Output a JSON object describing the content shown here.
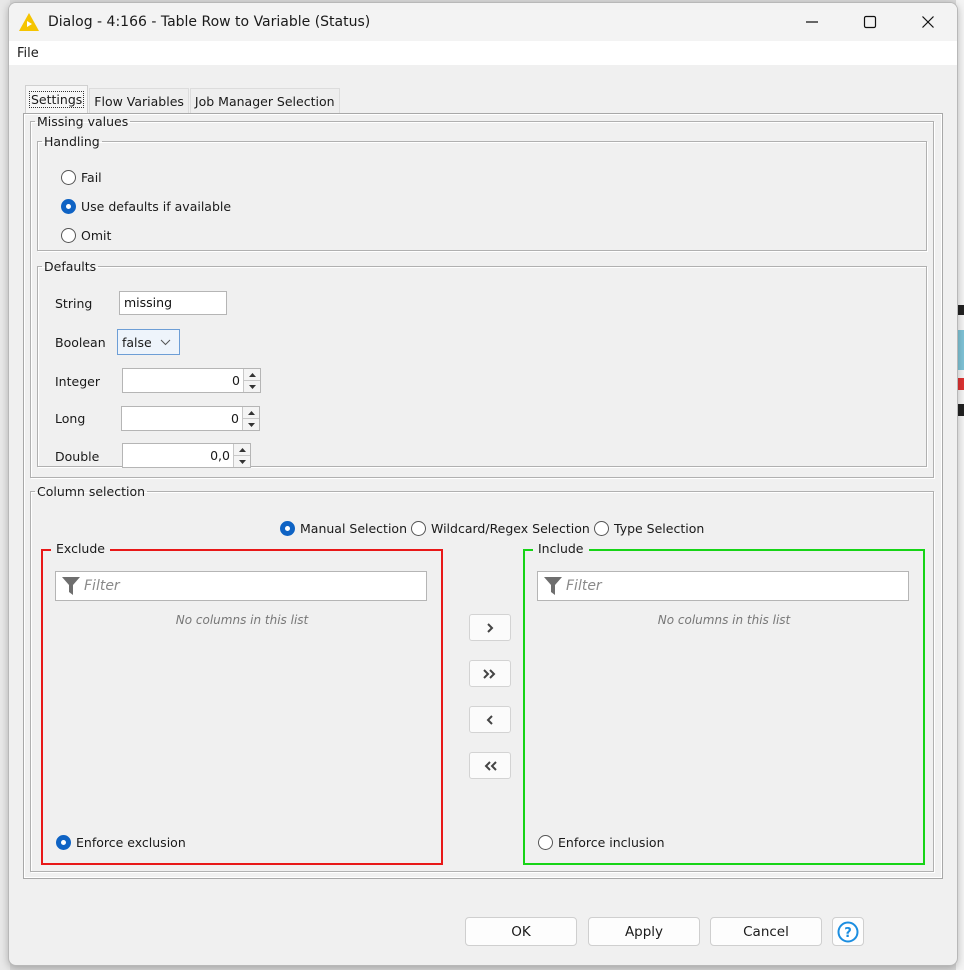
{
  "window": {
    "title": "Dialog - 4:166 - Table Row to Variable (Status)",
    "app_icon": "knime-warning-triangle-icon",
    "controls": [
      "minimize-icon",
      "maximize-icon",
      "close-icon"
    ]
  },
  "menubar": {
    "items": [
      {
        "label": "File"
      }
    ]
  },
  "tabs": [
    {
      "label": "Settings",
      "active": true
    },
    {
      "label": "Flow Variables",
      "active": false
    },
    {
      "label": "Job Manager Selection",
      "active": false
    }
  ],
  "settings": {
    "missing_values": {
      "legend": "Missing values",
      "handling": {
        "legend": "Handling",
        "options": [
          {
            "label": "Fail",
            "checked": false
          },
          {
            "label": "Use defaults if available",
            "checked": true
          },
          {
            "label": "Omit",
            "checked": false
          }
        ]
      },
      "defaults": {
        "legend": "Defaults",
        "string": {
          "label": "String",
          "value": "missing"
        },
        "boolean": {
          "label": "Boolean",
          "value": "false"
        },
        "integer": {
          "label": "Integer",
          "value": "0"
        },
        "long": {
          "label": "Long",
          "value": "0"
        },
        "double": {
          "label": "Double",
          "value": "0,0"
        }
      }
    },
    "column_selection": {
      "legend": "Column selection",
      "modes": [
        {
          "label": "Manual Selection",
          "checked": true
        },
        {
          "label": "Wildcard/Regex Selection",
          "checked": false
        },
        {
          "label": "Type Selection",
          "checked": false
        }
      ],
      "exclude": {
        "title": "Exclude",
        "filter_placeholder": "Filter",
        "empty_message": "No columns in this list",
        "enforce_label": "Enforce exclusion",
        "enforce_checked": true,
        "border_color": "#e81818"
      },
      "include": {
        "title": "Include",
        "filter_placeholder": "Filter",
        "empty_message": "No columns in this list",
        "enforce_label": "Enforce inclusion",
        "enforce_checked": false,
        "border_color": "#16d416"
      },
      "move_buttons": [
        {
          "name": "add-selected",
          "glyph": "›"
        },
        {
          "name": "add-all",
          "glyph": "»"
        },
        {
          "name": "remove-selected",
          "glyph": "‹"
        },
        {
          "name": "remove-all",
          "glyph": "«"
        }
      ]
    }
  },
  "footer": {
    "ok": "OK",
    "apply": "Apply",
    "cancel": "Cancel",
    "help_icon": "help-question-icon"
  },
  "colors": {
    "accent_blue": "#0f63c4",
    "exclude_red": "#e81818",
    "include_green": "#16d416",
    "title_icon_yellow": "#f5c400"
  }
}
